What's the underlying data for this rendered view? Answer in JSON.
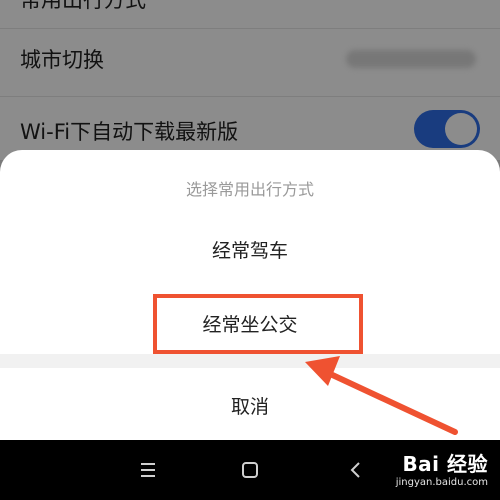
{
  "settings": {
    "rows": [
      {
        "label": "常用出行方式"
      },
      {
        "label": "城市切换"
      },
      {
        "label": "Wi-Fi下自动下载最新版"
      }
    ],
    "wifi_toggle_on": true
  },
  "sheet": {
    "title": "选择常用出行方式",
    "options": [
      {
        "label": "经常驾车"
      },
      {
        "label": "经常坐公交"
      }
    ],
    "cancel_label": "取消"
  },
  "colors": {
    "toggle_on": "#2f6ee8",
    "annotation": "#ef5231"
  },
  "navbar": {
    "menu_icon": "menu-icon",
    "home_icon": "home-icon",
    "back_icon": "back-icon"
  },
  "watermark": {
    "logo": "Bai 经验",
    "url": "jingyan.baidu.com"
  }
}
